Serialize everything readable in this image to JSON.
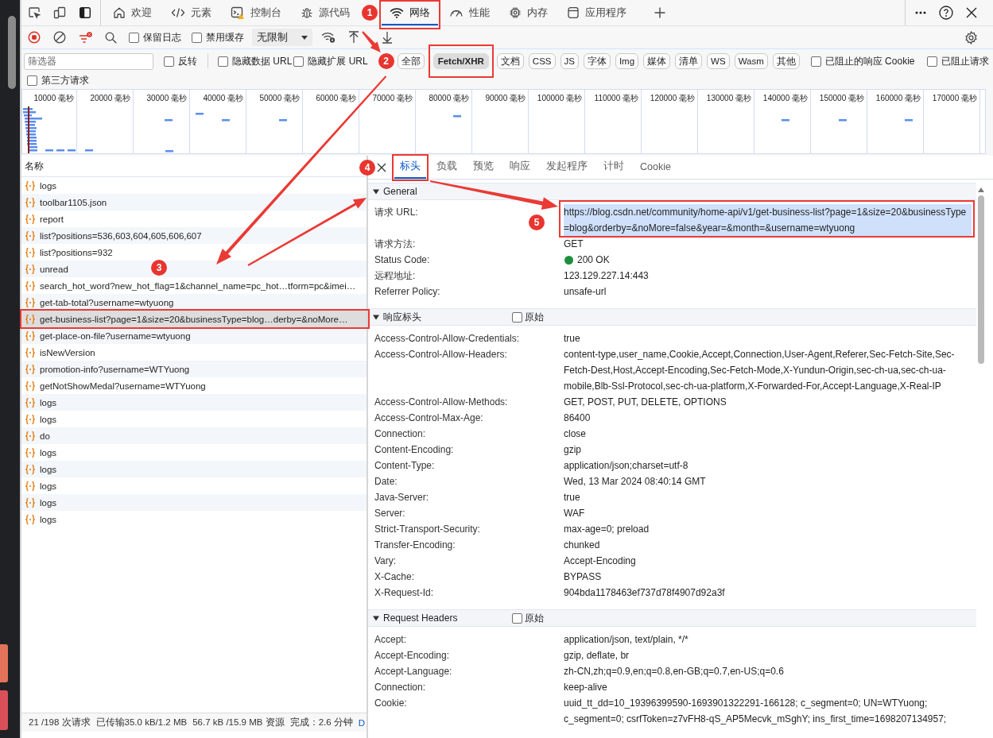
{
  "tabs": [
    {
      "label": "欢迎",
      "selected": false
    },
    {
      "label": "元素",
      "selected": false
    },
    {
      "label": "控制台",
      "selected": false
    },
    {
      "label": "源代码",
      "selected": false
    },
    {
      "label": "网络",
      "selected": true
    },
    {
      "label": "性能",
      "selected": false
    },
    {
      "label": "内存",
      "selected": false
    },
    {
      "label": "应用程序",
      "selected": false
    }
  ],
  "network_toolbar": {
    "recording": true,
    "options": [
      {
        "label": "保留日志",
        "checked": false
      },
      {
        "label": "禁用缓存",
        "checked": false
      }
    ],
    "throttling": "无限制"
  },
  "filter_bar": {
    "placeholder": "筛选器",
    "options": [
      {
        "label": "反转",
        "checked": false
      },
      {
        "label": "隐藏数据 URL",
        "checked": false
      },
      {
        "label": "隐藏扩展 URL",
        "checked": false
      }
    ],
    "types": [
      {
        "label": "全部",
        "selected": false
      },
      {
        "label": "Fetch/XHR",
        "selected": true
      },
      {
        "label": "文档",
        "selected": false
      },
      {
        "label": "CSS",
        "selected": false
      },
      {
        "label": "JS",
        "selected": false
      },
      {
        "label": "字体",
        "selected": false
      },
      {
        "label": "Img",
        "selected": false
      },
      {
        "label": "媒体",
        "selected": false
      },
      {
        "label": "清单",
        "selected": false
      },
      {
        "label": "WS",
        "selected": false
      },
      {
        "label": "Wasm",
        "selected": false
      },
      {
        "label": "其他",
        "selected": false
      }
    ],
    "blocked_options": [
      {
        "label": "已阻止的响应 Cookie",
        "checked": false
      },
      {
        "label": "已阻止请求",
        "checked": false
      }
    ],
    "third_party": {
      "label": "第三方请求",
      "checked": false
    }
  },
  "timeline": {
    "ticks": [
      "10000 毫秒",
      "20000 毫秒",
      "30000 毫秒",
      "40000 毫秒",
      "50000 毫秒",
      "60000 毫秒",
      "70000 毫秒",
      "80000 毫秒",
      "90000 毫秒",
      "100000 毫秒",
      "110000 毫秒",
      "120000 毫秒",
      "130000 毫秒",
      "140000 毫秒",
      "150000 毫秒",
      "160000 毫秒",
      "170000 毫秒"
    ]
  },
  "requests": {
    "column": "名称",
    "rows": [
      {
        "name": "logs",
        "selected": false
      },
      {
        "name": "toolbar1105.json",
        "selected": false
      },
      {
        "name": "report",
        "selected": false
      },
      {
        "name": "list?positions=536,603,604,605,606,607",
        "selected": false
      },
      {
        "name": "list?positions=932",
        "selected": false
      },
      {
        "name": "unread",
        "selected": false
      },
      {
        "name": "search_hot_word?new_hot_flag=1&channel_name=pc_hot…tform=pc&imei…",
        "selected": false
      },
      {
        "name": "get-tab-total?username=wtyuong",
        "selected": false
      },
      {
        "name": "get-business-list?page=1&size=20&businessType=blog…derby=&noMore…",
        "selected": true
      },
      {
        "name": "get-place-on-file?username=wtyuong",
        "selected": false
      },
      {
        "name": "isNewVersion",
        "selected": false
      },
      {
        "name": "promotion-info?username=WTYuong",
        "selected": false
      },
      {
        "name": "getNotShowMedal?username=WTYuong",
        "selected": false
      },
      {
        "name": "logs",
        "selected": false
      },
      {
        "name": "logs",
        "selected": false
      },
      {
        "name": "do",
        "selected": false
      },
      {
        "name": "logs",
        "selected": false
      },
      {
        "name": "logs",
        "selected": false
      },
      {
        "name": "logs",
        "selected": false
      },
      {
        "name": "logs",
        "selected": false
      },
      {
        "name": "logs",
        "selected": false
      }
    ]
  },
  "status_bar": [
    {
      "text": "21 /198 次请求",
      "kind": "stat"
    },
    {
      "text": "已传输35.0 kB/1.2 MB",
      "kind": "stat"
    },
    {
      "text": "56.7 kB /15.9 MB 资源",
      "kind": "stat"
    },
    {
      "text": "完成：2.6 分钟",
      "kind": "stat"
    },
    {
      "text": "D",
      "kind": "event"
    }
  ],
  "details": {
    "tabs": [
      {
        "label": "标头",
        "selected": true
      },
      {
        "label": "负载",
        "selected": false
      },
      {
        "label": "预览",
        "selected": false
      },
      {
        "label": "响应",
        "selected": false
      },
      {
        "label": "发起程序",
        "selected": false
      },
      {
        "label": "计时",
        "selected": false
      },
      {
        "label": "Cookie",
        "selected": false
      }
    ],
    "sections": [
      {
        "title": "General",
        "expanded": true,
        "rows": [
          {
            "name": "请求 URL:",
            "value": "https://blog.csdn.net/community/home-api/v1/get-business-list?page=1&size=20&businessType=blog&orderby=&noMore=false&year=&month=&username=wtyuong",
            "kind": "text",
            "highlighted": true
          },
          {
            "name": "请求方法:",
            "value": "GET",
            "kind": "text",
            "highlighted": false
          },
          {
            "name": "Status Code:",
            "value": "200 OK",
            "kind": "status",
            "color": "#1e8e3e",
            "highlighted": false
          },
          {
            "name": "远程地址:",
            "value": "123.129.227.14:443",
            "kind": "text",
            "highlighted": false
          },
          {
            "name": "Referrer Policy:",
            "value": "unsafe-url",
            "kind": "text",
            "highlighted": false
          }
        ]
      },
      {
        "title": "响应标头",
        "expanded": true,
        "raw": {
          "label": "原始",
          "checked": false
        },
        "rows": [
          {
            "name": "Access-Control-Allow-Credentials:",
            "value": "true"
          },
          {
            "name": "Access-Control-Allow-Headers:",
            "value": "content-type,user_name,Cookie,Accept,Connection,User-Agent,Referer,Sec-Fetch-Site,Sec-Fetch-Dest,Host,Accept-Encoding,Sec-Fetch-Mode,X-Yundun-Origin,sec-ch-ua,sec-ch-ua-mobile,Blb-Ssl-Protocol,sec-ch-ua-platform,X-Forwarded-For,Accept-Language,X-Real-IP"
          },
          {
            "name": "Access-Control-Allow-Methods:",
            "value": "GET, POST, PUT, DELETE, OPTIONS"
          },
          {
            "name": "Access-Control-Max-Age:",
            "value": "86400"
          },
          {
            "name": "Connection:",
            "value": "close"
          },
          {
            "name": "Content-Encoding:",
            "value": "gzip"
          },
          {
            "name": "Content-Type:",
            "value": "application/json;charset=utf-8"
          },
          {
            "name": "Date:",
            "value": "Wed, 13 Mar 2024 08:40:14 GMT"
          },
          {
            "name": "Java-Server:",
            "value": "true"
          },
          {
            "name": "Server:",
            "value": "WAF"
          },
          {
            "name": "Strict-Transport-Security:",
            "value": "max-age=0; preload"
          },
          {
            "name": "Transfer-Encoding:",
            "value": "chunked"
          },
          {
            "name": "Vary:",
            "value": "Accept-Encoding"
          },
          {
            "name": "X-Cache:",
            "value": "BYPASS"
          },
          {
            "name": "X-Request-Id:",
            "value": "904bda1178463ef737d78f4907d92a3f"
          }
        ]
      },
      {
        "title": "Request Headers",
        "expanded": true,
        "raw": {
          "label": "原始",
          "checked": false
        },
        "rows": [
          {
            "name": "Accept:",
            "value": "application/json, text/plain, */*"
          },
          {
            "name": "Accept-Encoding:",
            "value": "gzip, deflate, br"
          },
          {
            "name": "Accept-Language:",
            "value": "zh-CN,zh;q=0.9,en;q=0.8,en-GB;q=0.7,en-US;q=0.6"
          },
          {
            "name": "Connection:",
            "value": "keep-alive"
          },
          {
            "name": "Cookie:",
            "value": "uuid_tt_dd=10_19396399590-1693901322291-166128; c_segment=0; UN=WTYuong; c_segment=0; csrfToken=z7vFH8-qS_AP5Mecvk_mSghY; ins_first_time=1698207134957;"
          }
        ]
      }
    ]
  },
  "annotations": [
    "1",
    "2",
    "3",
    "4",
    "5"
  ]
}
